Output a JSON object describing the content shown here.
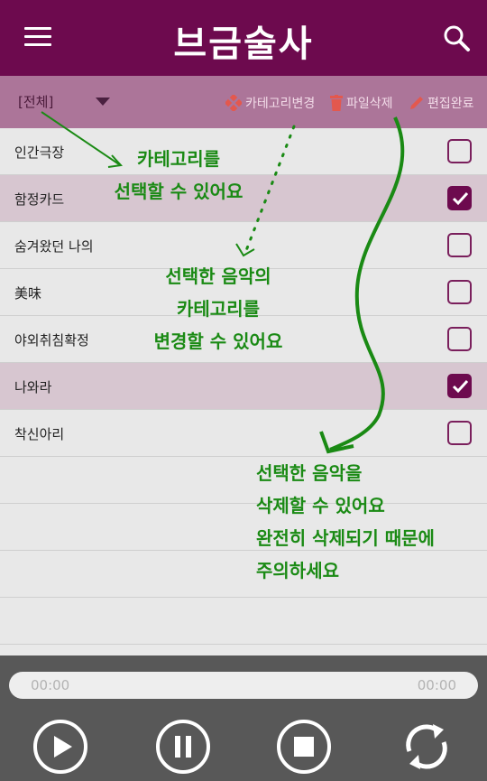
{
  "app": {
    "title": "브금술사"
  },
  "toolbar": {
    "category_value": "[전체]",
    "change_category_label": "카테고리변경",
    "delete_label": "파일삭제",
    "done_label": "편집완료"
  },
  "songs": [
    {
      "title": "인간극장",
      "checked": false
    },
    {
      "title": "함정카드",
      "checked": true
    },
    {
      "title": "숨겨왔던 나의",
      "checked": false
    },
    {
      "title": "美味",
      "checked": false
    },
    {
      "title": "야외취침확정",
      "checked": false
    },
    {
      "title": "나와라",
      "checked": true
    },
    {
      "title": "착신아리",
      "checked": false
    }
  ],
  "annotations": {
    "note1": [
      "카테고리를",
      "선택할 수 있어요"
    ],
    "note2": [
      "선택한 음악의",
      "카테고리를",
      "변경할 수 있어요"
    ],
    "note3": [
      "선택한 음악을",
      "삭제할 수 있어요",
      "완전히 삭제되기 때문에",
      "주의하세요"
    ]
  },
  "player": {
    "current_time": "00:00",
    "total_time": "00:00"
  },
  "colors": {
    "header": "#6d0a4e",
    "toolbar": "#ac7599",
    "selected_row": "#d7c6d0",
    "annotation_green": "#1a8a14",
    "player_bg": "#585858"
  },
  "icons": [
    "menu-icon",
    "search-icon",
    "category-icon",
    "trash-icon",
    "pencil-icon",
    "play-icon",
    "pause-icon",
    "stop-icon",
    "repeat-icon",
    "checkmark-icon"
  ]
}
